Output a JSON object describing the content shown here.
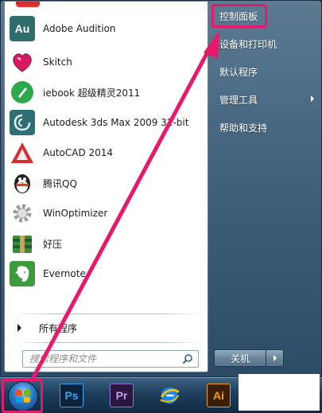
{
  "start_menu": {
    "programs": [
      {
        "label": "Adobe Audition",
        "icon": "adobe-audition-icon",
        "icon_text": "Au",
        "color": "#2f6d6d"
      },
      {
        "label": "Skitch",
        "icon": "skitch-icon",
        "icon_text": "",
        "color": "#c2185b"
      },
      {
        "label": "iebook 超级精灵2011",
        "icon": "iebook-icon",
        "icon_text": "",
        "color": "#29a645"
      },
      {
        "label": "Autodesk 3ds Max 2009 32-bit",
        "icon": "3ds-max-icon",
        "icon_text": "",
        "color": "#2f6f73"
      },
      {
        "label": "AutoCAD 2014",
        "icon": "autocad-icon",
        "icon_text": "",
        "color": "#d32f2f"
      },
      {
        "label": "腾讯QQ",
        "icon": "qq-penguin-icon",
        "icon_text": "",
        "color": "#222222"
      },
      {
        "label": "WinOptimizer",
        "icon": "winoptimizer-gear-icon",
        "icon_text": "",
        "color": "#9e9e9e"
      },
      {
        "label": "好压",
        "icon": "haozip-icon",
        "icon_text": "",
        "color": "#3d8a3d"
      },
      {
        "label": "Evernote",
        "icon": "evernote-elephant-icon",
        "icon_text": "",
        "color": "#3d9a3d"
      }
    ],
    "all_programs_label": "所有程序",
    "search": {
      "placeholder": "搜索程序和文件"
    },
    "right_items": [
      {
        "label": "控制面板",
        "highlighted": true,
        "has_submenu": false
      },
      {
        "label": "设备和打印机",
        "highlighted": false,
        "has_submenu": false
      },
      {
        "label": "默认程序",
        "highlighted": false,
        "has_submenu": false
      },
      {
        "label": "管理工具",
        "highlighted": false,
        "has_submenu": true
      },
      {
        "label": "帮助和支持",
        "highlighted": false,
        "has_submenu": false
      }
    ],
    "shutdown_label": "关机"
  },
  "taskbar": {
    "start_button_icon": "windows-orb-icon",
    "pinned": [
      {
        "name": "photoshop",
        "text": "Ps",
        "bg": "#0b2238",
        "fg": "#31a8ff"
      },
      {
        "name": "premiere",
        "text": "Pr",
        "bg": "#2a1740",
        "fg": "#c49bf2"
      },
      {
        "name": "ie-globe",
        "text": "",
        "bg": "#1a4f8a",
        "fg": "#ffd54f"
      },
      {
        "name": "illustrator",
        "text": "Ai",
        "bg": "#3a1f07",
        "fg": "#ff9a00"
      }
    ]
  },
  "colors": {
    "annotation": "#e8186a"
  }
}
